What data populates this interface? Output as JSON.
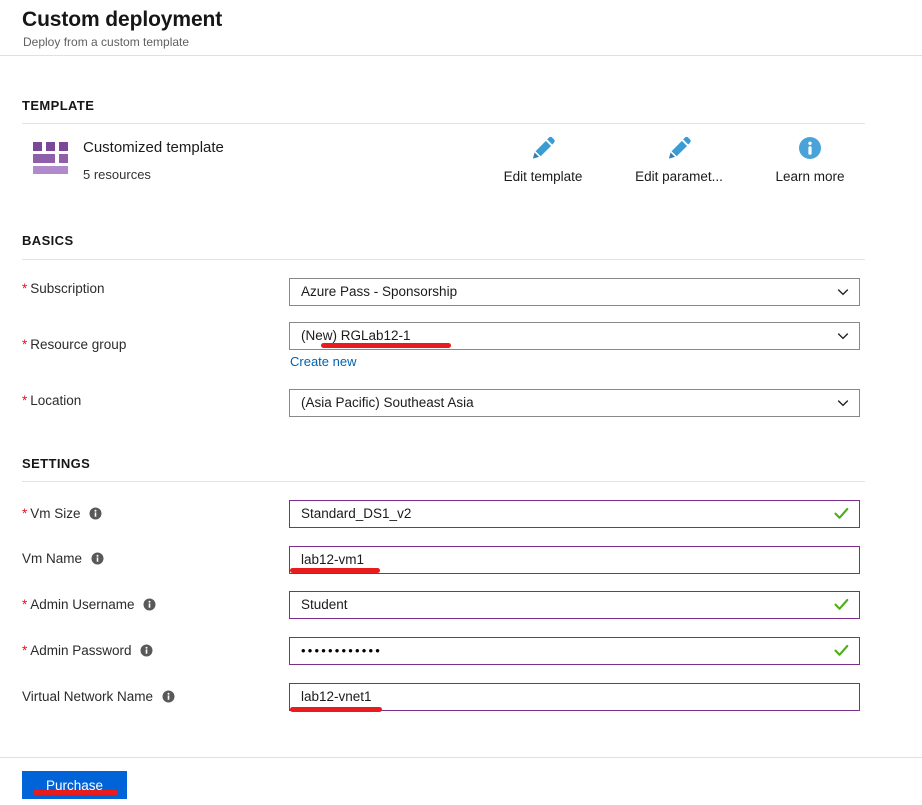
{
  "header": {
    "title": "Custom deployment",
    "subtitle": "Deploy from a custom template"
  },
  "sections": {
    "template": "TEMPLATE",
    "basics": "BASICS",
    "settings": "SETTINGS"
  },
  "template": {
    "name": "Customized template",
    "resources": "5 resources",
    "icon": "template-grid-icon",
    "actions": [
      {
        "label": "Edit template",
        "icon": "pencil-icon"
      },
      {
        "label": "Edit paramet...",
        "icon": "pencil-icon"
      },
      {
        "label": "Learn more",
        "icon": "info-circle-icon"
      }
    ]
  },
  "basics": {
    "subscription": {
      "label": "Subscription",
      "required": true,
      "value": "Azure Pass - Sponsorship"
    },
    "resource_group": {
      "label": "Resource group",
      "required": true,
      "value": "(New) RGLab12-1",
      "create_new": "Create new"
    },
    "location": {
      "label": "Location",
      "required": true,
      "value": "(Asia Pacific) Southeast Asia"
    }
  },
  "settings": {
    "vm_size": {
      "label": "Vm Size",
      "required": true,
      "value": "Standard_DS1_v2",
      "valid": true
    },
    "vm_name": {
      "label": "Vm Name",
      "required": false,
      "value": "lab12-vm1",
      "valid": false
    },
    "admin_username": {
      "label": "Admin Username",
      "required": true,
      "value": "Student",
      "valid": true
    },
    "admin_password": {
      "label": "Admin Password",
      "required": true,
      "value": "••••••••••••",
      "valid": true
    },
    "vnet_name": {
      "label": "Virtual Network Name",
      "required": false,
      "value": "lab12-vnet1",
      "valid": false
    }
  },
  "footer": {
    "purchase_label": "Purchase"
  },
  "colors": {
    "accent_blue": "#0063d8",
    "link_blue": "#0063b1",
    "required_red": "#e81123",
    "marker_red": "#e81c1c",
    "field_purple": "#7c2e8f",
    "field_gray": "#8a8886",
    "valid_green": "#4caf17",
    "template_purple": "#7c4799",
    "icon_blue": "#3b9bd4"
  }
}
